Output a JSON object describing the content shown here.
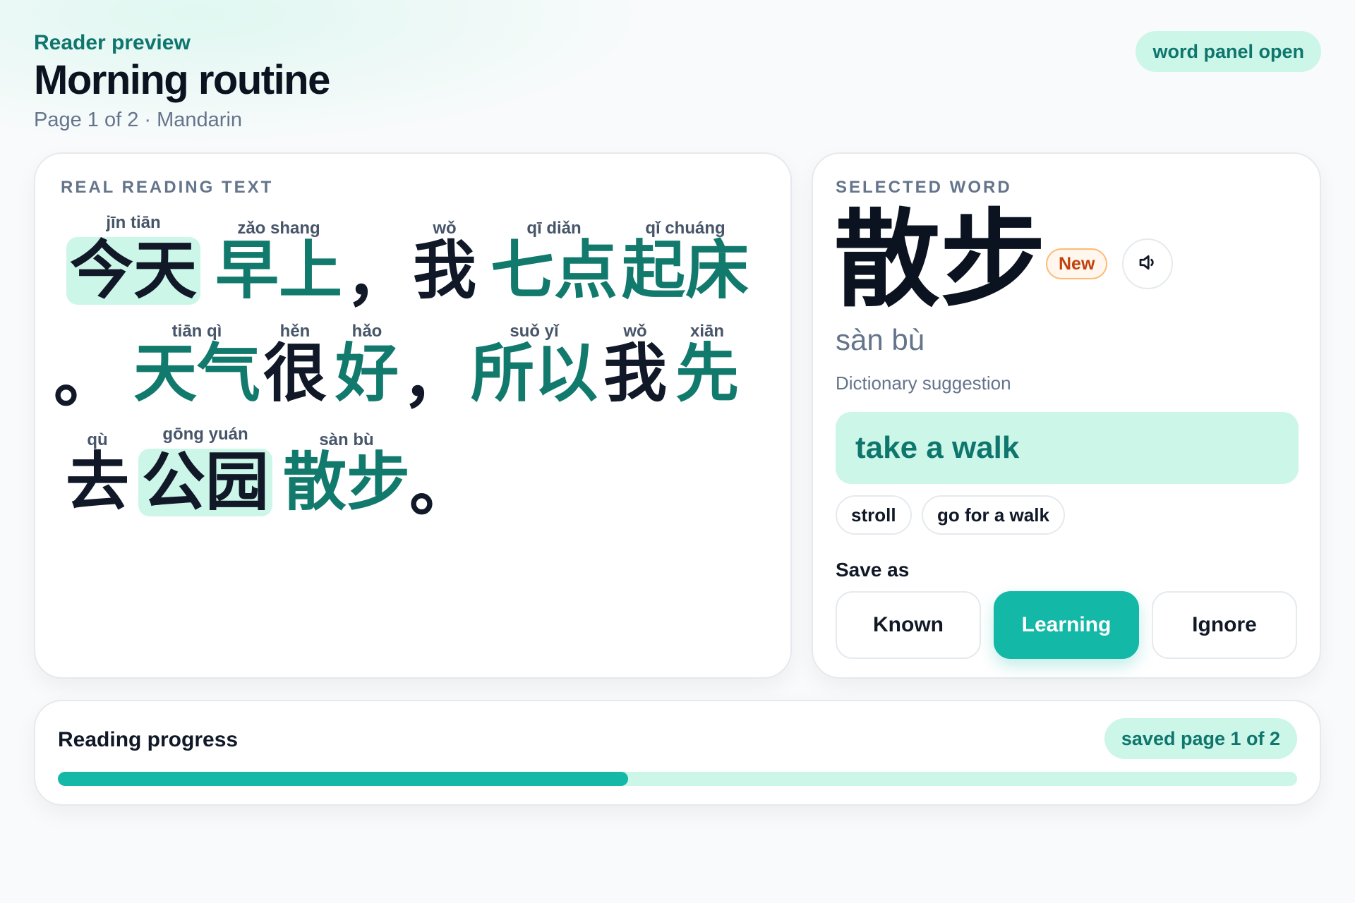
{
  "header": {
    "eyebrow": "Reader preview",
    "title": "Morning routine",
    "subtitle": "Page 1 of 2 · Mandarin",
    "status": "word panel open"
  },
  "reading": {
    "label": "REAL READING TEXT",
    "tokens": [
      {
        "hanzi": "今天",
        "pinyin": "jīn tiān"
      },
      {
        "hanzi": "早上",
        "pinyin": "zǎo shang"
      },
      {
        "hanzi": "，",
        "pinyin": ""
      },
      {
        "hanzi": "我",
        "pinyin": "wǒ"
      },
      {
        "hanzi": "七点",
        "pinyin": "qī diǎn"
      },
      {
        "hanzi": "起床",
        "pinyin": "qǐ chuáng"
      },
      {
        "hanzi": "。",
        "pinyin": ""
      },
      {
        "hanzi": "天气",
        "pinyin": "tiān qì"
      },
      {
        "hanzi": "很",
        "pinyin": "hěn"
      },
      {
        "hanzi": "好",
        "pinyin": "hǎo"
      },
      {
        "hanzi": "，",
        "pinyin": ""
      },
      {
        "hanzi": "所以",
        "pinyin": "suǒ yǐ"
      },
      {
        "hanzi": "我",
        "pinyin": "wǒ"
      },
      {
        "hanzi": "先",
        "pinyin": "xiān"
      },
      {
        "hanzi": "去",
        "pinyin": "qù"
      },
      {
        "hanzi": "公园",
        "pinyin": "gōng yuán"
      },
      {
        "hanzi": "散步",
        "pinyin": "sàn bù"
      },
      {
        "hanzi": "。",
        "pinyin": ""
      }
    ]
  },
  "word_panel": {
    "label": "SELECTED WORD",
    "hanzi": "散步",
    "badge": "New",
    "audio_icon": "speaker-icon",
    "pinyin": "sàn bù",
    "dict_label": "Dictionary suggestion",
    "translation": "take a walk",
    "alternatives": [
      "stroll",
      "go for a walk"
    ],
    "save_label": "Save as",
    "save_options": [
      "Known",
      "Learning",
      "Ignore"
    ],
    "selected_option": "Learning"
  },
  "progress": {
    "title": "Reading progress",
    "status": "saved page 1 of 2",
    "fraction": 0.46
  },
  "colors": {
    "accent": "#14b8a6",
    "accent_soft": "#ccf6e8",
    "teal_text": "#117a6d",
    "badge_new": "#c2410c"
  }
}
